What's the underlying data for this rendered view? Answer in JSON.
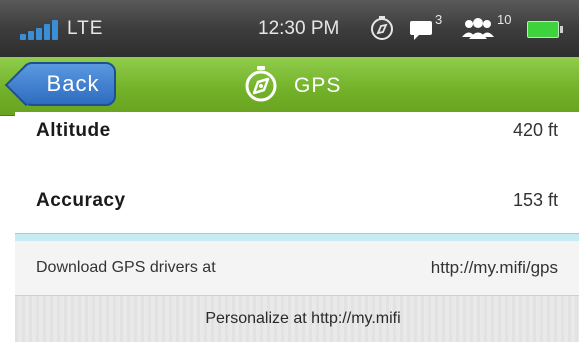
{
  "status_bar": {
    "network": "LTE",
    "time": "12:30 PM",
    "messages_count": "3",
    "connected_devices_count": "10",
    "signal_level": 5,
    "battery_level": 1.0
  },
  "header": {
    "back_label": "Back",
    "title": "GPS",
    "icon": "compass-icon"
  },
  "rows": [
    {
      "label": "Altitude",
      "value": "420 ft"
    },
    {
      "label": "Accuracy",
      "value": "153 ft"
    }
  ],
  "info": {
    "label": "Download GPS drivers at",
    "url": "http://my.mifi/gps"
  },
  "footer": {
    "text": "Personalize at http://my.mifi"
  },
  "colors": {
    "header_green": "#7dbb35",
    "back_blue": "#3a7bd0",
    "signal_blue": "#3a8ed8",
    "battery_green": "#3ed23c"
  }
}
